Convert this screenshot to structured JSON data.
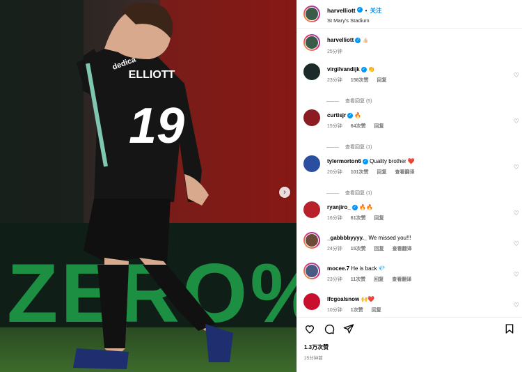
{
  "post": {
    "username": "harvelliott",
    "follow_label": "关注",
    "location": "St Mary's Stadium",
    "caption_emoji": "👍🏻",
    "caption_time": "25分钟",
    "jersey_name": "ELLIOTT",
    "jersey_number": "19",
    "sponsor": "dedica",
    "board_text": "ZERO%"
  },
  "comments": [
    {
      "user": "virgilvandijk",
      "text": "👏",
      "time": "23分钟",
      "likes": "158次赞",
      "reply": "回复",
      "view_replies": "查看回复 (5)"
    },
    {
      "user": "curtisjr",
      "text": "🔥",
      "time": "15分钟",
      "likes": "64次赞",
      "reply": "回复",
      "view_replies": "查看回复 (1)"
    },
    {
      "user": "tylermorton6",
      "text": "Quality brother ❤️",
      "time": "20分钟",
      "likes": "101次赞",
      "reply": "回复",
      "translate": "查看翻译",
      "view_replies": "查看回复 (1)"
    },
    {
      "user": "ryanjiro_",
      "text": "🔥🔥",
      "time": "16分钟",
      "likes": "61次赞",
      "reply": "回复"
    },
    {
      "user": "_gabbbbyyyy._",
      "text": "We missed you!!!",
      "time": "24分钟",
      "likes": "15次赞",
      "reply": "回复",
      "translate": "查看翻译"
    },
    {
      "user": "mocee.7",
      "text": "He is back 💎",
      "time": "23分钟",
      "likes": "11次赞",
      "reply": "回复",
      "translate": "查看翻译"
    },
    {
      "user": "lfcgoalsnow",
      "text": "🙌❤️",
      "time": "10分钟",
      "likes": "1次赞",
      "reply": "回复"
    }
  ],
  "footer": {
    "likes": "1.3万次赞",
    "time": "25分钟前"
  },
  "colors": {
    "accent": "#0095f6",
    "verified": "#0095f6"
  }
}
